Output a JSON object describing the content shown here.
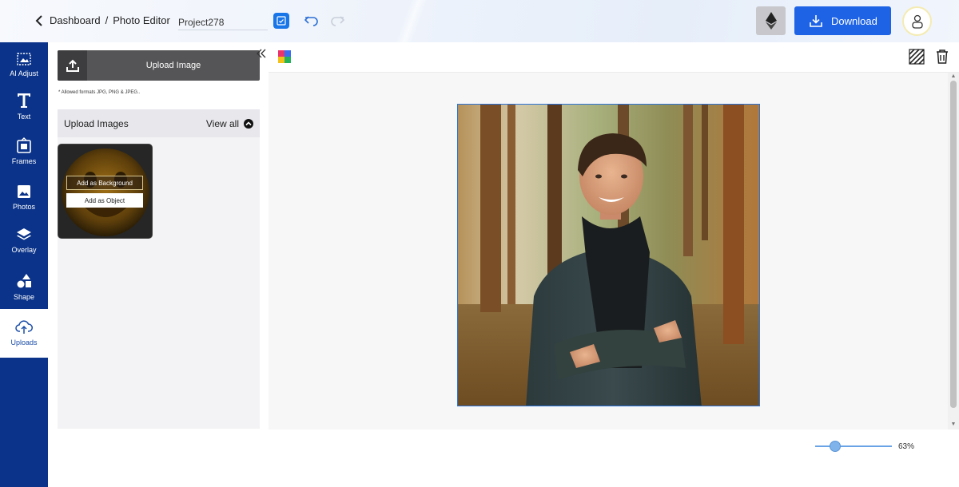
{
  "header": {
    "breadcrumb_root": "Dashboard",
    "breadcrumb_sep": "/",
    "breadcrumb_current": "Photo Editor",
    "project_name": "Project278",
    "download_label": "Download"
  },
  "nav": {
    "items": [
      {
        "label": "AI Adjust",
        "icon": "ai-adjust-icon"
      },
      {
        "label": "Text",
        "icon": "text-icon"
      },
      {
        "label": "Frames",
        "icon": "frames-icon"
      },
      {
        "label": "Photos",
        "icon": "photos-icon"
      },
      {
        "label": "Overlay",
        "icon": "overlay-icon"
      },
      {
        "label": "Shape",
        "icon": "shape-icon"
      },
      {
        "label": "Uploads",
        "icon": "upload-cloud-icon"
      }
    ],
    "active": "Uploads"
  },
  "panel": {
    "upload_button": "Upload Image",
    "allowed_formats": "* Allowed formats JPG, PNG & JPEG..",
    "section_title": "Upload Images",
    "view_all": "View all",
    "thumb_add_background": "Add as Background",
    "thumb_add_object": "Add as Object"
  },
  "zoom": {
    "value_label": "63%",
    "value": 0.63
  },
  "colors": {
    "accent": "#1e63e6",
    "nav_bg": "#0a3389",
    "selection": "#2a72d8"
  }
}
